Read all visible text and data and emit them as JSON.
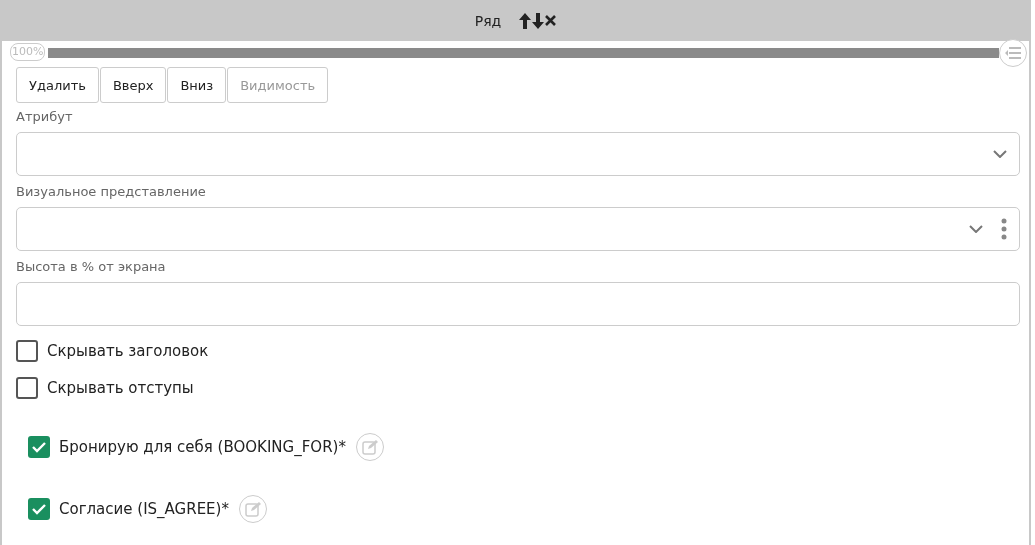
{
  "header": {
    "title": "Ряд"
  },
  "progress": {
    "label": "100%",
    "level": 1
  },
  "buttons": [
    {
      "label": "Удалить",
      "disabled": false
    },
    {
      "label": "Вверх",
      "disabled": false
    },
    {
      "label": "Вниз",
      "disabled": false
    },
    {
      "label": "Видимость",
      "disabled": true
    }
  ],
  "fields": [
    {
      "label": "Атрибут",
      "kind": "select"
    },
    {
      "label": "Визуальное представление",
      "kind": "selectmenu"
    },
    {
      "label": "Высота в % от экрана",
      "kind": "text"
    }
  ],
  "options": [
    {
      "label": "Скрывать заголовок",
      "checked": false
    },
    {
      "label": "Скрывать отступы",
      "checked": false
    }
  ],
  "items": [
    {
      "label": "Бронирую для себя (BOOKING_FOR)*",
      "checked": true
    },
    {
      "label": "Согласие (IS_AGREE)*",
      "checked": true
    }
  ]
}
